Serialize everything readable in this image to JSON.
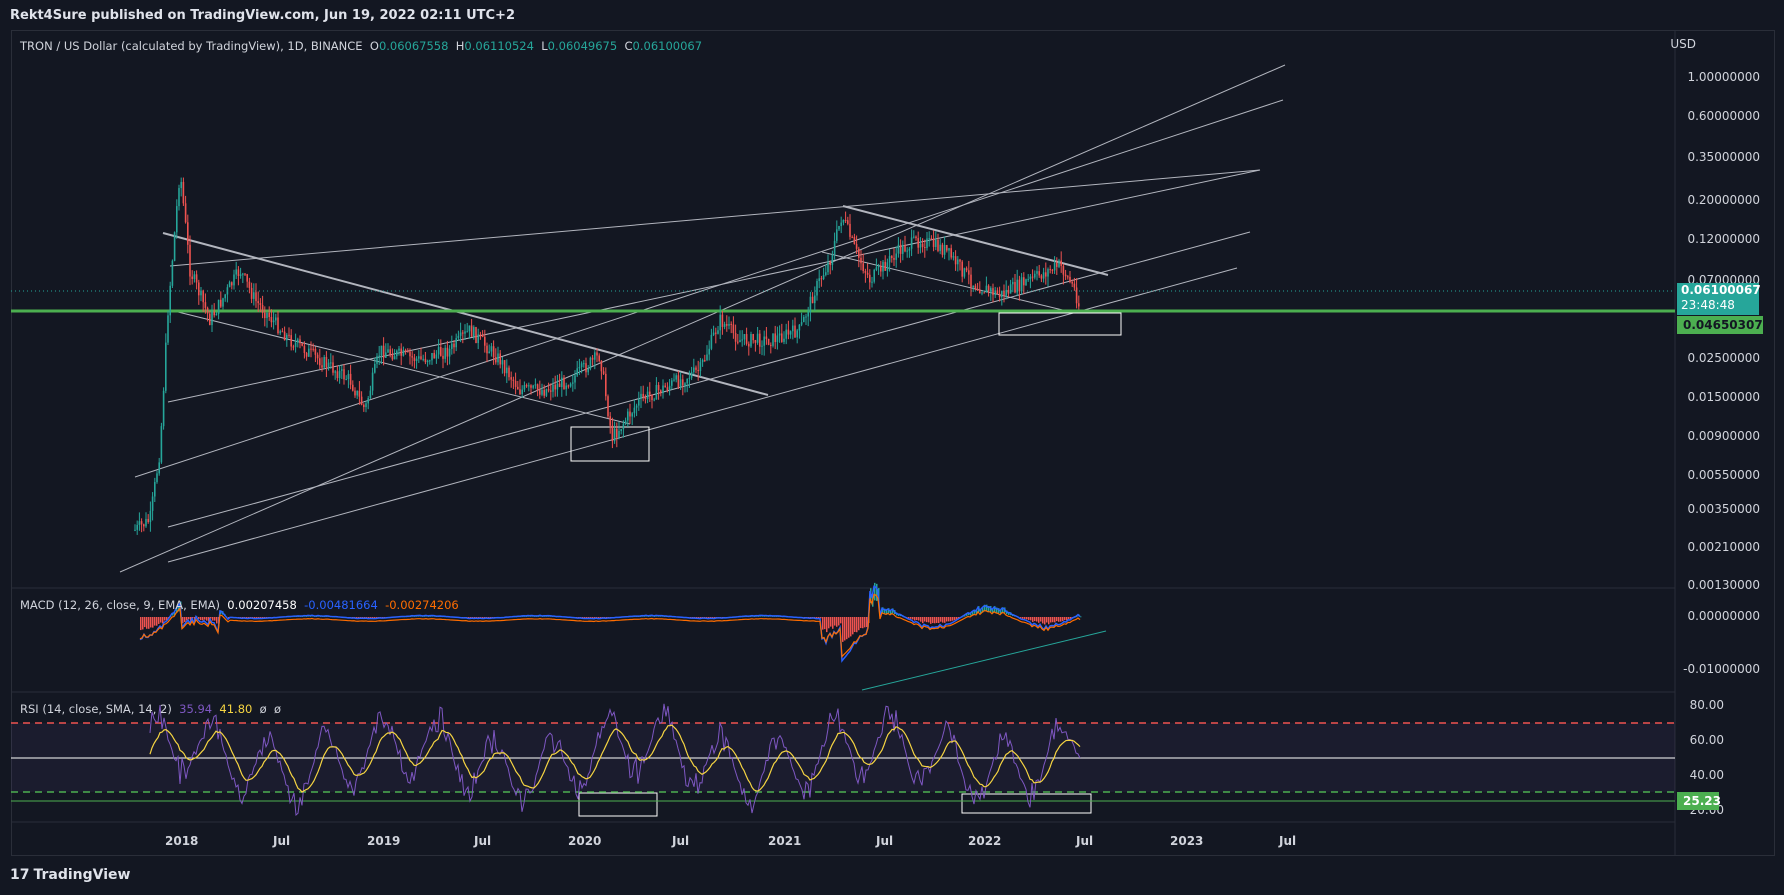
{
  "publisher": "Rekt4Sure published on TradingView.com, Jun 19, 2022 02:11 UTC+2",
  "footer_brand": "TradingView",
  "footer_logo": "17",
  "currency": "USD",
  "symbol_title": "TRON / US Dollar (calculated by TradingView), 1D, BINANCE",
  "ohlc": {
    "o_label": "O",
    "o": "0.06067558",
    "h_label": "H",
    "h": "0.06110524",
    "l_label": "L",
    "l": "0.06049675",
    "c_label": "C",
    "c": "0.06100067"
  },
  "price_scale": [
    "1.00000000",
    "0.60000000",
    "0.35000000",
    "0.20000000",
    "0.12000000",
    "0.07000000",
    "0.02500000",
    "0.01500000",
    "0.00900000",
    "0.00550000",
    "0.00350000",
    "0.00210000",
    "0.00130000"
  ],
  "current_price": "0.06100067",
  "countdown": "23:48:48",
  "support_price": "0.04650307",
  "macd_legend": {
    "label": "MACD (12, 26, close, 9, EMA, EMA)",
    "v1": "0.00207458",
    "v2": "-0.00481664",
    "v3": "-0.00274206"
  },
  "macd_scale": [
    "0.00000000",
    "-0.01000000"
  ],
  "rsi_legend": {
    "label": "RSI (14, close, SMA, 14, 2)",
    "v1": "35.94",
    "v2": "41.80",
    "v3": "ø",
    "v4": "ø"
  },
  "rsi_scale": [
    "80.00",
    "60.00",
    "40.00",
    "20.00"
  ],
  "rsi_current": "25.23",
  "time_axis": [
    "2018",
    "Jul",
    "2019",
    "Jul",
    "2020",
    "Jul",
    "2021",
    "Jul",
    "2022",
    "Jul",
    "2023",
    "Jul"
  ],
  "colors": {
    "background": "#131722",
    "up": "#26a69a",
    "down": "#ef5350",
    "support_line": "#4caf50",
    "rsi_line": "#7e57c2",
    "rsi_sma": "#f5d442",
    "macd_line": "#2962ff",
    "signal_line": "#ff6d00"
  }
}
